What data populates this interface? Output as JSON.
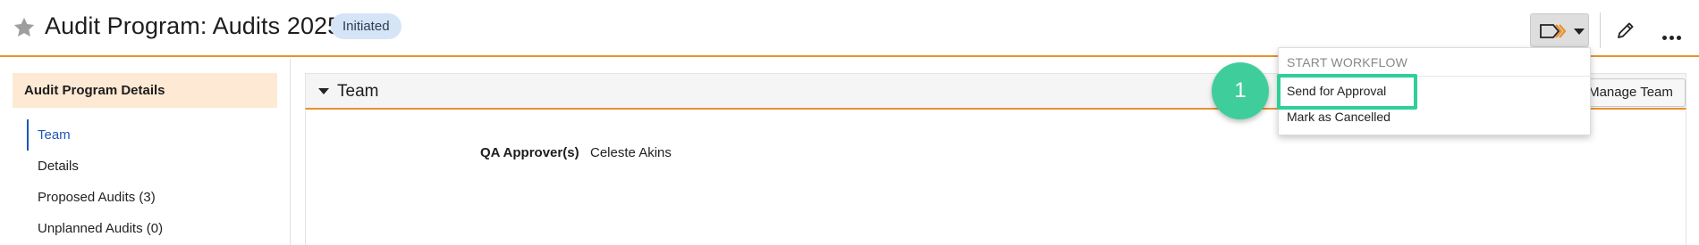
{
  "header": {
    "title": "Audit Program: Audits 2025",
    "status": "Initiated",
    "star_icon": "star-icon",
    "workflow_icon": "workflow-arrows-icon",
    "edit_icon": "pencil-icon",
    "more_icon": "more-horizontal-icon"
  },
  "sidebar": {
    "heading": "Audit Program Details",
    "items": [
      {
        "label": "Team",
        "active": true
      },
      {
        "label": "Details",
        "active": false
      },
      {
        "label": "Proposed Audits (3)",
        "active": false
      },
      {
        "label": "Unplanned Audits (0)",
        "active": false
      }
    ]
  },
  "main": {
    "section_title": "Team",
    "manage_button": "Manage Team",
    "fields": [
      {
        "label": "QA Approver(s)",
        "value": "Celeste Akins"
      }
    ]
  },
  "workflow_menu": {
    "heading": "START WORKFLOW",
    "items": [
      "Send for Approval",
      "Mark as Cancelled"
    ]
  },
  "annotation": {
    "step": "1"
  },
  "colors": {
    "accent_orange": "#e8912e",
    "active_link": "#1f56b8",
    "highlight_green": "#2fcf98",
    "badge_bg": "#d6e4f7"
  }
}
